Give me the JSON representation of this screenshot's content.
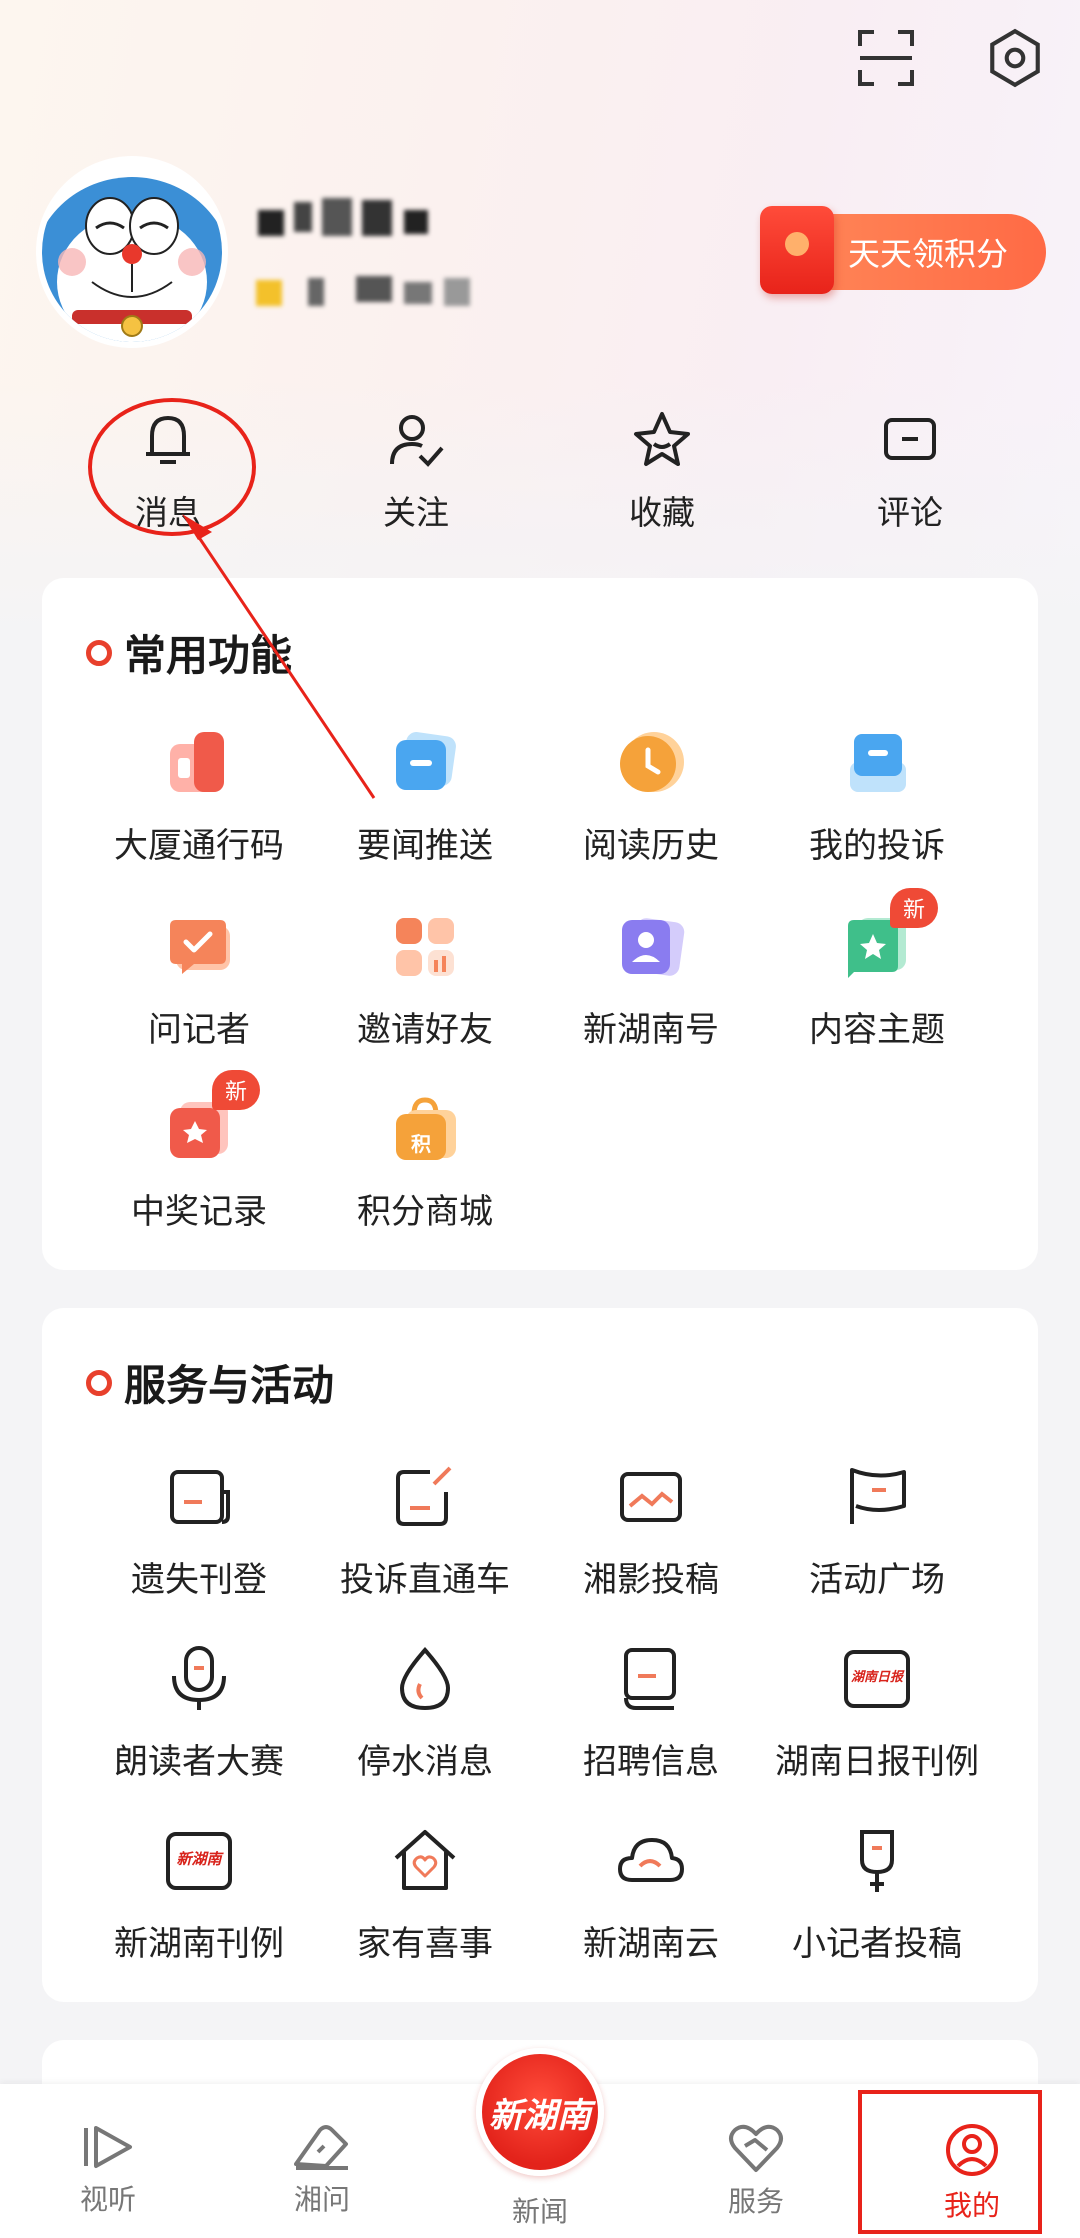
{
  "header": {
    "scan_icon": "scan-icon",
    "settings_icon": "settings-icon"
  },
  "profile": {
    "points_button": "天天领积分"
  },
  "quick_actions": [
    {
      "label": "消息",
      "icon": "bell-icon"
    },
    {
      "label": "关注",
      "icon": "user-check-icon"
    },
    {
      "label": "收藏",
      "icon": "star-icon"
    },
    {
      "label": "评论",
      "icon": "comment-icon"
    }
  ],
  "common_functions": {
    "title": "常用功能",
    "items": [
      {
        "label": "大厦通行码",
        "icon": "building-pass-icon",
        "color": "#f05a4a"
      },
      {
        "label": "要闻推送",
        "icon": "news-push-icon",
        "color": "#4aa6f0"
      },
      {
        "label": "阅读历史",
        "icon": "clock-icon",
        "color": "#f5a23a"
      },
      {
        "label": "我的投诉",
        "icon": "complaint-icon",
        "color": "#4aa6f0"
      },
      {
        "label": "问记者",
        "icon": "chat-check-icon",
        "color": "#f5845a"
      },
      {
        "label": "邀请好友",
        "icon": "apps-icon",
        "color": "#f5845a"
      },
      {
        "label": "新湖南号",
        "icon": "account-card-icon",
        "color": "#8a7cf0"
      },
      {
        "label": "内容主题",
        "icon": "topic-icon",
        "color": "#3fbf8a",
        "badge": "新"
      },
      {
        "label": "中奖记录",
        "icon": "prize-icon",
        "color": "#f05a4a",
        "badge": "新"
      },
      {
        "label": "积分商城",
        "icon": "shop-bag-icon",
        "color": "#f5a23a",
        "glyph": "积"
      }
    ]
  },
  "services": {
    "title": "服务与活动",
    "items": [
      {
        "label": "遗失刊登",
        "icon": "notice-icon"
      },
      {
        "label": "投诉直通车",
        "icon": "edit-box-icon"
      },
      {
        "label": "湘影投稿",
        "icon": "photo-icon"
      },
      {
        "label": "活动广场",
        "icon": "flag-icon"
      },
      {
        "label": "朗读者大赛",
        "icon": "microphone-icon"
      },
      {
        "label": "停水消息",
        "icon": "water-drop-icon"
      },
      {
        "label": "招聘信息",
        "icon": "document-icon"
      },
      {
        "label": "湖南日报刊例",
        "icon": "hunan-daily-icon",
        "glyph": "湖南日报"
      },
      {
        "label": "新湖南刊例",
        "icon": "new-hunan-icon",
        "glyph": "新湖南"
      },
      {
        "label": "家有喜事",
        "icon": "home-heart-icon"
      },
      {
        "label": "新湖南云",
        "icon": "cloud-icon"
      },
      {
        "label": "小记者投稿",
        "icon": "reporter-mic-icon"
      }
    ]
  },
  "bottom_nav": [
    {
      "label": "视听",
      "icon": "play-icon"
    },
    {
      "label": "湘问",
      "icon": "ask-icon"
    },
    {
      "label": "新闻",
      "icon": "news-logo",
      "logo": "新湖南"
    },
    {
      "label": "服务",
      "icon": "service-heart-icon"
    },
    {
      "label": "我的",
      "icon": "profile-icon",
      "active": true
    }
  ],
  "colors": {
    "accent": "#e8231a",
    "active_nav": "#e8231a"
  }
}
